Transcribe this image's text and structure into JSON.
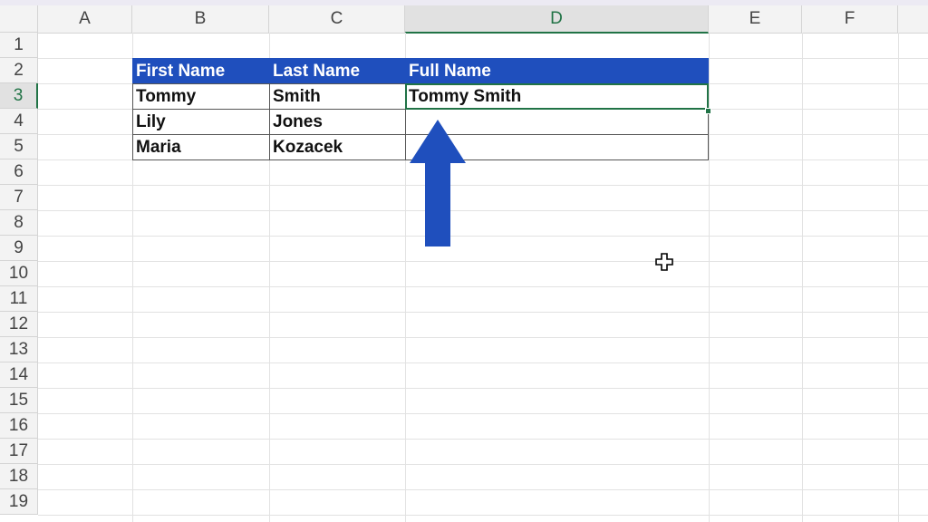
{
  "columns": [
    "A",
    "B",
    "C",
    "D",
    "E",
    "F"
  ],
  "active_column": "D",
  "rows": [
    "1",
    "2",
    "3",
    "4",
    "5",
    "6",
    "7",
    "8",
    "9",
    "10",
    "11",
    "12",
    "13",
    "14",
    "15",
    "16",
    "17",
    "18",
    "19"
  ],
  "active_row": "3",
  "table": {
    "headers": [
      "First Name",
      "Last Name",
      "Full Name"
    ],
    "rows": [
      [
        "Tommy",
        "Smith",
        "Tommy Smith"
      ],
      [
        "Lily",
        "Jones",
        ""
      ],
      [
        "Maria",
        "Kozacek",
        ""
      ]
    ]
  },
  "colors": {
    "header_fill": "#1f4fbd",
    "arrow_fill": "#1f4fbd",
    "selection": "#217346"
  },
  "icons": {
    "cursor": "cell-select-cross-icon",
    "arrow": "up-arrow-icon"
  }
}
